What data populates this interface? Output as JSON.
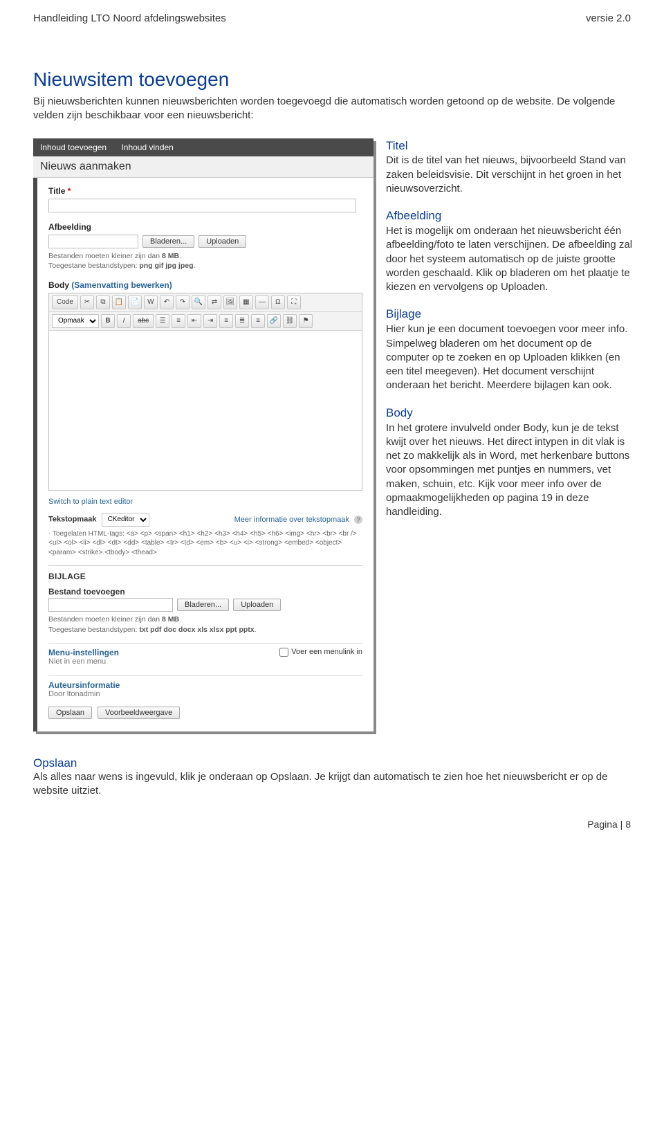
{
  "header": {
    "left": "Handleiding LTO Noord afdelingswebsites",
    "right": "versie 2.0"
  },
  "section": {
    "heading": "Nieuwsitem toevoegen",
    "intro": "Bij nieuwsberichten kunnen nieuwsberichten worden toegevoegd die automatisch worden getoond op de website. De volgende velden zijn beschikbaar voor een nieuwsbericht:"
  },
  "descs": {
    "titel": {
      "h": "Titel",
      "body": "Dit is de titel van het nieuws, bijvoorbeeld Stand van zaken beleidsvisie. Dit verschijnt in het groen in het nieuwsoverzicht."
    },
    "afbeelding": {
      "h": "Afbeelding",
      "body": "Het is mogelijk om onderaan het nieuwsbericht één afbeelding/foto te laten verschijnen. De afbeelding zal door het systeem automatisch op de juiste grootte worden geschaald. Klik op bladeren om het plaatje te kiezen en vervolgens op Uploaden."
    },
    "bijlage": {
      "h": "Bijlage",
      "body": "Hier kun je een document toevoegen voor meer info. Simpelweg bladeren om het document op de computer op te zoeken en op Uploaden klikken (en een titel meegeven). Het document verschijnt onderaan het bericht. Meerdere bijlagen kan ook."
    },
    "body": {
      "h": "Body",
      "body": "In het grotere invulveld onder Body, kun je de tekst kwijt over het nieuws. Het direct intypen in dit vlak is net zo makkelijk als in Word, met herkenbare buttons voor opsommingen met puntjes en nummers, vet maken, schuin, etc. Kijk voor meer info over de opmaakmogelijkheden op pagina 19 in deze handleiding."
    }
  },
  "shot": {
    "tab1": "Inhoud toevoegen",
    "tab2": "Inhoud vinden",
    "pagetitle": "Nieuws aanmaken",
    "labels": {
      "title": "Title",
      "required": "*",
      "afbeelding": "Afbeelding",
      "body_prefix": "Body",
      "body_link": "(Samenvatting bewerken)"
    },
    "buttons": {
      "bladeren": "Bladeren...",
      "uploaden": "Uploaden",
      "opslaan": "Opslaan",
      "voorbeeld": "Voorbeeldweergave"
    },
    "help_afb_l1": "Bestanden moeten kleiner zijn dan ",
    "help_afb_l1b": "8 MB",
    "help_afb_l2": "Toegestane bestandstypen: ",
    "help_afb_l2b": "png gif jpg jpeg",
    "editor": {
      "code": "Code",
      "opmaak": "Opmaak",
      "B": "B",
      "I": "I",
      "abc": "abc"
    },
    "plainlink": "Switch to plain text editor",
    "tekstopmaak_label": "Tekstopmaak",
    "tekstopmaak_value": "CKeditor",
    "meer_info": "Meer informatie over tekstopmaak",
    "tags_intro": "· Toegelaten HTML-tags: ",
    "tags": "<a> <p> <span> <h1> <h2> <h3> <h4> <h5> <h6> <img> <hr> <br> <br /> <ul> <ol> <li> <dl> <dt> <dd> <table> <tr> <td> <em> <b> <u> <i> <strong> <embed> <object> <param> <strike> <tbody> <thead>",
    "bijlage_head": "BIJLAGE",
    "bestand_toevoegen": "Bestand toevoegen",
    "help_bij_l2b": "txt pdf doc docx xls xlsx ppt pptx",
    "menu_title": "Menu-instellingen",
    "menu_sub": "Niet in een menu",
    "menu_check": "Voer een menulink in",
    "auteur_title": "Auteursinformatie",
    "auteur_sub": "Door ltonadmin"
  },
  "opslaan": {
    "h": "Opslaan",
    "body": "Als alles naar wens is ingevuld, klik je onderaan op Opslaan. Je krijgt dan automatisch te zien hoe het nieuwsbericht er op de website uitziet."
  },
  "footer": "Pagina | 8"
}
